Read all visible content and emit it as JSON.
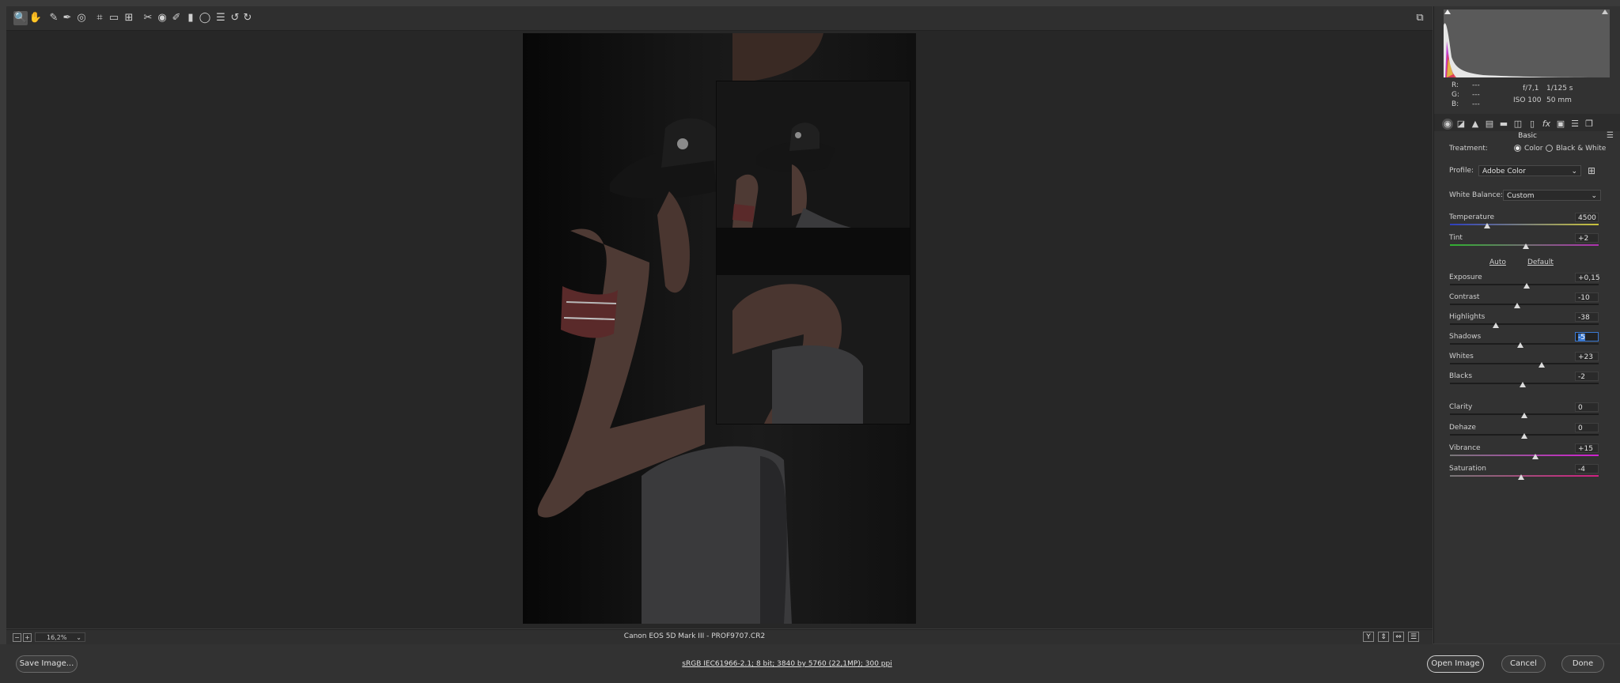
{
  "toolbar": {
    "tools": [
      {
        "name": "zoom-tool",
        "glyph": "🔍"
      },
      {
        "name": "hand-tool",
        "glyph": "✋"
      },
      {
        "name": "white-balance-tool",
        "glyph": "✎"
      },
      {
        "name": "color-sampler-tool",
        "glyph": "✒"
      },
      {
        "name": "targeted-adjustment-tool",
        "glyph": "◎"
      },
      {
        "name": "crop-tool",
        "glyph": "⌗"
      },
      {
        "name": "straighten-tool",
        "glyph": "▭"
      },
      {
        "name": "transform-tool",
        "glyph": "⊞"
      },
      {
        "name": "spot-removal-tool",
        "glyph": "✂"
      },
      {
        "name": "red-eye-tool",
        "glyph": "◉"
      },
      {
        "name": "adjustment-brush-tool",
        "glyph": "✐"
      },
      {
        "name": "graduated-filter-tool",
        "glyph": "▮"
      },
      {
        "name": "radial-filter-tool",
        "glyph": "◯"
      },
      {
        "name": "preferences-tool",
        "glyph": "☰"
      },
      {
        "name": "rotate-left-tool",
        "glyph": "↺"
      },
      {
        "name": "rotate-right-tool",
        "glyph": "↻"
      }
    ],
    "fullscreen_glyph": "⧉"
  },
  "status": {
    "zoom": "16,2%",
    "camera": "Canon EOS 5D Mark III  -  PROF9707.CR2",
    "view_buttons": [
      "Y",
      "⇕",
      "⇔",
      "☰"
    ]
  },
  "bottom": {
    "save": "Save Image...",
    "workflow": "sRGB IEC61966-2.1; 8 bit; 3840 by 5760 (22,1MP); 300 ppi",
    "open": "Open Image",
    "cancel": "Cancel",
    "done": "Done"
  },
  "info": {
    "r_label": "R:",
    "g_label": "G:",
    "b_label": "B:",
    "r": "---",
    "g": "---",
    "b": "---",
    "aperture": "f/7,1",
    "shutter": "1/125 s",
    "iso": "ISO 100",
    "focal": "50 mm"
  },
  "panel": {
    "title": "Basic",
    "treatment_label": "Treatment:",
    "treatment_color": "Color",
    "treatment_bw": "Black & White",
    "profile_label": "Profile:",
    "profile_value": "Adobe Color",
    "wb_label": "White Balance:",
    "wb_value": "Custom",
    "auto": "Auto",
    "default": "Default",
    "sliders": [
      {
        "label": "Temperature",
        "value": "4500",
        "level": 0.25
      },
      {
        "label": "Tint",
        "value": "+2",
        "level": 0.51
      },
      {
        "label": "Exposure",
        "value": "+0,15",
        "level": 0.515
      },
      {
        "label": "Contrast",
        "value": "-10",
        "level": 0.45
      },
      {
        "label": "Highlights",
        "value": "-38",
        "level": 0.31
      },
      {
        "label": "Shadows",
        "value": "-5",
        "level": 0.475
      },
      {
        "label": "Whites",
        "value": "+23",
        "level": 0.615
      },
      {
        "label": "Blacks",
        "value": "-2",
        "level": 0.49
      },
      {
        "label": "Clarity",
        "value": "0",
        "level": 0.5
      },
      {
        "label": "Dehaze",
        "value": "0",
        "level": 0.5
      },
      {
        "label": "Vibrance",
        "value": "+15",
        "level": 0.575
      },
      {
        "label": "Saturation",
        "value": "-4",
        "level": 0.48
      }
    ]
  },
  "colors": {
    "temperature_gradient": [
      "#2d3fbf",
      "#c9c33a"
    ],
    "tint_gradient": [
      "#30b030",
      "#b030b0"
    ],
    "vibrance_gradient": [
      "#777777",
      "#d020d0"
    ],
    "saturation_gradient": [
      "#777777",
      "#d02080"
    ],
    "selection": "#3a78d0"
  }
}
